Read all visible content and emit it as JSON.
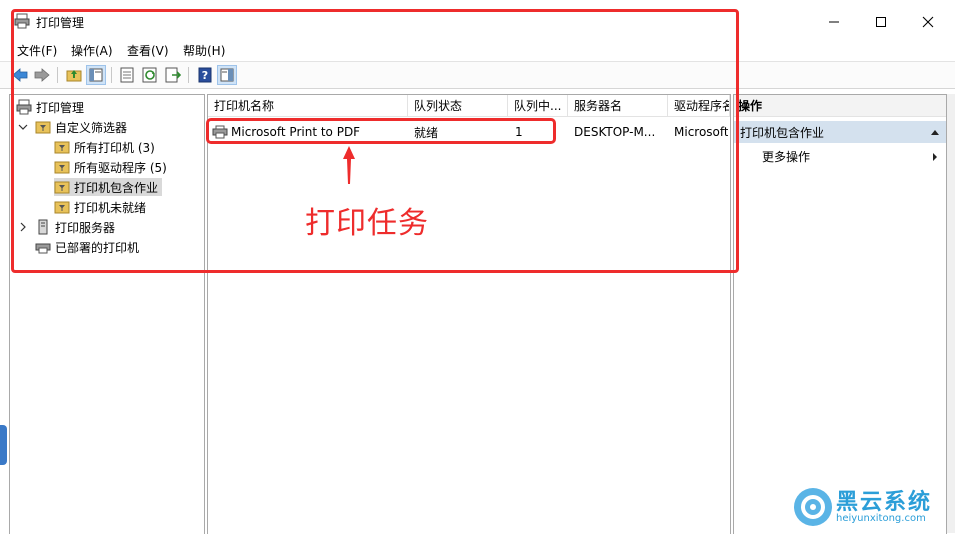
{
  "window": {
    "title": "打印管理"
  },
  "menu": [
    {
      "label": "文件(F)"
    },
    {
      "label": "操作(A)"
    },
    {
      "label": "查看(V)"
    },
    {
      "label": "帮助(H)"
    }
  ],
  "tree": {
    "root": "打印管理",
    "custom_filters": "自定义筛选器",
    "children": [
      {
        "label": "所有打印机 (3)"
      },
      {
        "label": "所有驱动程序 (5)"
      },
      {
        "label": "打印机包含作业"
      },
      {
        "label": "打印机未就绪"
      }
    ],
    "print_servers": "打印服务器",
    "deployed_printers": "已部署的打印机"
  },
  "list": {
    "columns": [
      {
        "label": "打印机名称"
      },
      {
        "label": "队列状态"
      },
      {
        "label": "队列中..."
      },
      {
        "label": "服务器名"
      },
      {
        "label": "驱动程序名"
      }
    ],
    "rows": [
      {
        "name": "Microsoft Print to PDF",
        "status": "就绪",
        "queue": "1",
        "server": "DESKTOP-M...",
        "driver": "Microsoft"
      }
    ]
  },
  "actions": {
    "header": "操作",
    "group": "打印机包含作业",
    "more": "更多操作"
  },
  "annotation": {
    "label": "打印任务",
    "color": "#ee2c2c"
  },
  "watermark": {
    "title": "黑云系统",
    "url": "heiyunxitong.com"
  }
}
